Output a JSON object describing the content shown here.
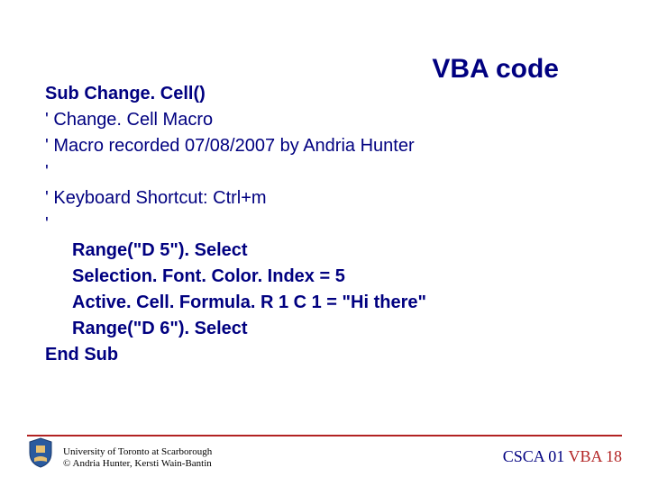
{
  "title": "VBA code",
  "code": {
    "l1a": "Sub ",
    "l1b": "Change. Cell()",
    "l2": "' Change. Cell Macro",
    "l3": "' Macro recorded 07/08/2007 by Andria Hunter",
    "l4": "'",
    "l5": "' Keyboard Shortcut: Ctrl+m",
    "l6": "'",
    "l7": "Range(\"D 5\"). Select",
    "l8": "Selection. Font. Color. Index = 5",
    "l9": "Active. Cell. Formula. R 1 C 1 = \"Hi there\"",
    "l10": "Range(\"D 6\"). Select",
    "l11": "End Sub"
  },
  "footer": {
    "uni": "University of Toronto at Scarborough",
    "copyright": "© Andria Hunter, Kersti Wain-Bantin",
    "course": "CSCA 01 ",
    "vba": "VBA ",
    "page": "18"
  }
}
